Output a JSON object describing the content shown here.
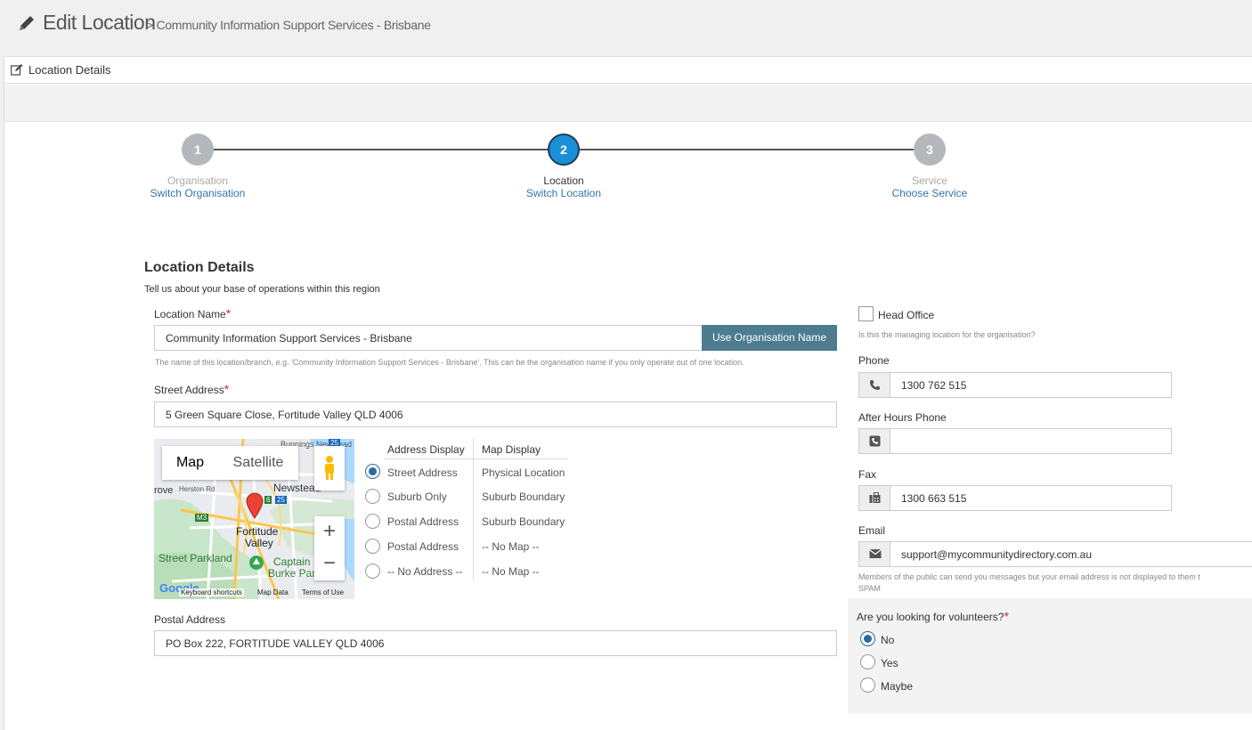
{
  "header": {
    "title": "Edit Location",
    "breadcrumb": "> Community Information Support Services - Brisbane"
  },
  "panel": {
    "title": "Location Details"
  },
  "steps": [
    {
      "number": "1",
      "name": "Organisation",
      "link": "Switch Organisation",
      "active": false
    },
    {
      "number": "2",
      "name": "Location",
      "link": "Switch Location",
      "active": true
    },
    {
      "number": "3",
      "name": "Service",
      "link": "Choose Service",
      "active": false
    }
  ],
  "section": {
    "title": "Location Details",
    "description": "Tell us about your base of operations within this region"
  },
  "location_name": {
    "label": "Location Name",
    "required": "*",
    "value": "Community Information Support Services - Brisbane",
    "button": "Use Organisation Name",
    "help": "The name of this location/branch, e.g. 'Community Information Support Services - Brisbane'. This can be the organisation name if you only operate out of one location."
  },
  "street_address": {
    "label": "Street Address",
    "required": "*",
    "value": "5 Green Square Close, Fortitude Valley QLD 4006"
  },
  "map": {
    "tab_map": "Map",
    "tab_satellite": "Satellite",
    "zoom_in": "+",
    "zoom_out": "−",
    "labels": {
      "fortitude": "Fortitude",
      "valley": "Valley",
      "newstead": "Newstead",
      "herston": "Herston Rd",
      "grove": "rove",
      "street_parkland": "Street Parkland",
      "captain": "Captain",
      "burke": "Burke Par",
      "m3": "M3",
      "r25": "25",
      "r6": "6",
      "bunnings": "Bunnings Newstead"
    },
    "footer": {
      "google": "Google",
      "keyboard": "Keyboard shortcuts",
      "map_data": "Map Data",
      "terms": "Terms of Use"
    }
  },
  "display": {
    "address_header": "Address Display",
    "map_header": "Map Display",
    "options": [
      {
        "address": "Street Address",
        "map": "Physical Location",
        "selected": true
      },
      {
        "address": "Suburb Only",
        "map": "Suburb Boundary",
        "selected": false
      },
      {
        "address": "Postal Address",
        "map": "Suburb Boundary",
        "selected": false
      },
      {
        "address": "Postal Address",
        "map": "-- No Map --",
        "selected": false
      },
      {
        "address": "-- No Address --",
        "map": "-- No Map --",
        "selected": false
      }
    ]
  },
  "postal_address": {
    "label": "Postal Address",
    "value": "PO Box 222, FORTITUDE VALLEY QLD 4006"
  },
  "head_office": {
    "label": "Head Office",
    "help": "Is this the managing location for the organisation?",
    "checked": false
  },
  "phone": {
    "label": "Phone",
    "value": "1300 762 515"
  },
  "after_hours_phone": {
    "label": "After Hours Phone",
    "value": ""
  },
  "fax": {
    "label": "Fax",
    "value": "1300 663 515"
  },
  "email": {
    "label": "Email",
    "value": "support@mycommunitydirectory.com.au",
    "help1": "Members of the public can send you messages but your email address is not displayed to them t",
    "help2": "SPAM"
  },
  "volunteers": {
    "label": "Are you looking for volunteers?",
    "required": "*",
    "options": [
      {
        "label": "No",
        "selected": true
      },
      {
        "label": "Yes",
        "selected": false
      },
      {
        "label": "Maybe",
        "selected": false
      }
    ]
  },
  "colors": {
    "accent": "#1a8fd8",
    "button": "#4d7c8f",
    "link": "#3a73a8",
    "required": "#c0392b"
  }
}
